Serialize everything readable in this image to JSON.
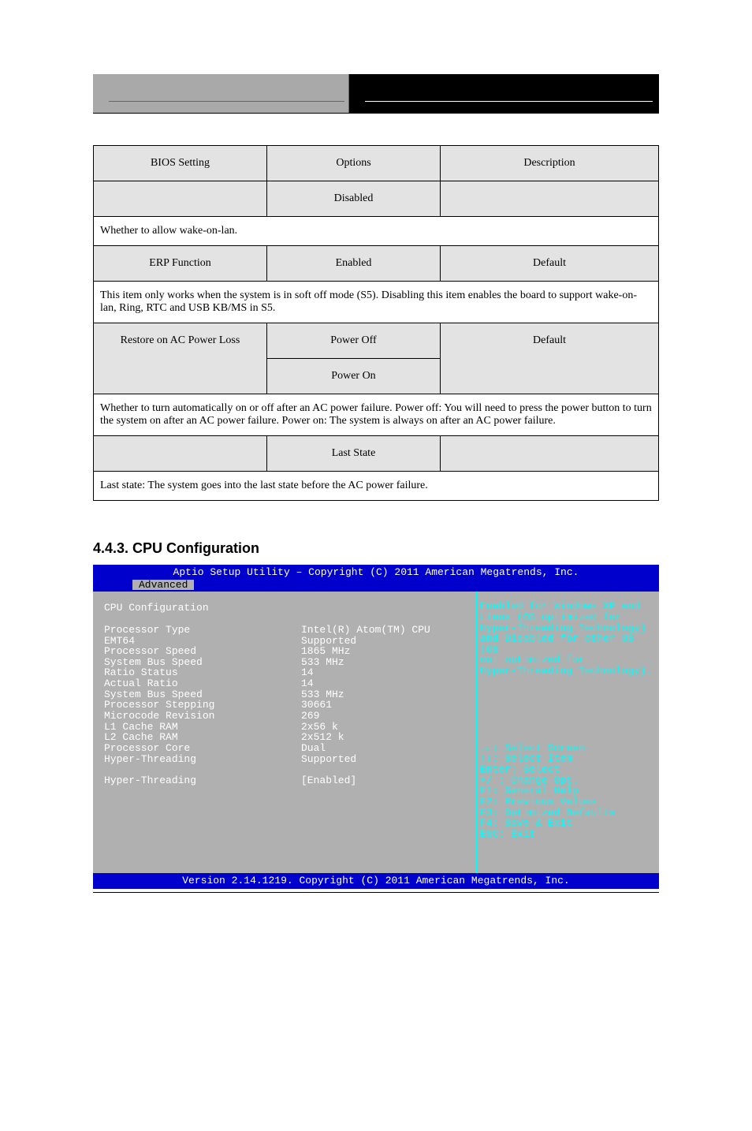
{
  "table": {
    "head": {
      "feature": "BIOS Setting",
      "opt": "Options",
      "desc": "Description"
    },
    "rows": [
      {
        "feature": "",
        "opt": "Disabled",
        "desc": "",
        "kind": "opt"
      },
      {
        "span": "Whether to allow wake-on-lan.",
        "kind": "desc"
      },
      {
        "feature": "ERP Function",
        "opt": "Enabled",
        "desc": "Default",
        "kind": "opt"
      },
      {
        "span": "This item only works when the system is in soft off mode (S5). Disabling this item enables the board to support wake-on-lan, Ring, RTC and USB KB/MS in S5.",
        "kind": "desc"
      },
      {
        "feature": "Restore on AC Power Loss",
        "opt": "Power Off",
        "desc": "Default",
        "kind": "opt-rowspan",
        "opt2": "Power On",
        "desc2": ""
      },
      {
        "span": "Whether to turn automatically on or off after an AC power failure. Power off: You will need to press the power button to turn the system on after an AC power failure. Power on: The system is always on after an AC power failure.",
        "kind": "desc"
      },
      {
        "feature": "",
        "opt": "Last State",
        "desc": "",
        "kind": "opt"
      },
      {
        "span": "Last state: The system goes into the last state before the AC power failure.",
        "kind": "desc"
      }
    ]
  },
  "section_title": "4.4.3. CPU Configuration",
  "bios": {
    "header": "Aptio Setup Utility – Copyright (C) 2011 American Megatrends, Inc.",
    "tab_active": "Advanced",
    "title": "CPU Configuration",
    "rows": [
      {
        "lbl": "Processor Type",
        "val": "Intel(R) Atom(TM) CPU"
      },
      {
        "lbl": "EMT64",
        "val": "Supported"
      },
      {
        "lbl": "Processor Speed",
        "val": "1865 MHz"
      },
      {
        "lbl": "System Bus Speed",
        "val": "533 MHz"
      },
      {
        "lbl": "Ratio Status",
        "val": "14"
      },
      {
        "lbl": "Actual Ratio",
        "val": "14"
      },
      {
        "lbl": "System Bus Speed",
        "val": "533 MHz"
      },
      {
        "lbl": "Processor Stepping",
        "val": "30661"
      },
      {
        "lbl": "Microcode Revision",
        "val": "269"
      },
      {
        "lbl": "L1 Cache RAM",
        "val": "2x56 k"
      },
      {
        "lbl": "L2 Cache RAM",
        "val": "2x512 k"
      },
      {
        "lbl": "Processor Core",
        "val": "Dual"
      },
      {
        "lbl": "Hyper-Threading",
        "val": "Supported"
      }
    ],
    "setting": {
      "lbl": "Hyper-Threading",
      "val": "[Enabled]"
    },
    "help": [
      "Enabled for Windows XP and",
      "Linux (OS optimized for",
      "Hyper-Threading Technology)",
      "and Disabled for other OS (OS",
      "not optimized for",
      "Hyper-Threading Technology)."
    ],
    "nav": [
      "→←: Select Screen",
      "↑↓: Select Item",
      "Enter: Select",
      "+/-: Change Opt.",
      "F1: General Help",
      "F2: Previous Values",
      "F3: Optimized Defaults",
      "F4: Save & Exit",
      "ESC: Exit"
    ],
    "footer": "Version 2.14.1219. Copyright (C) 2011 American Megatrends, Inc."
  }
}
